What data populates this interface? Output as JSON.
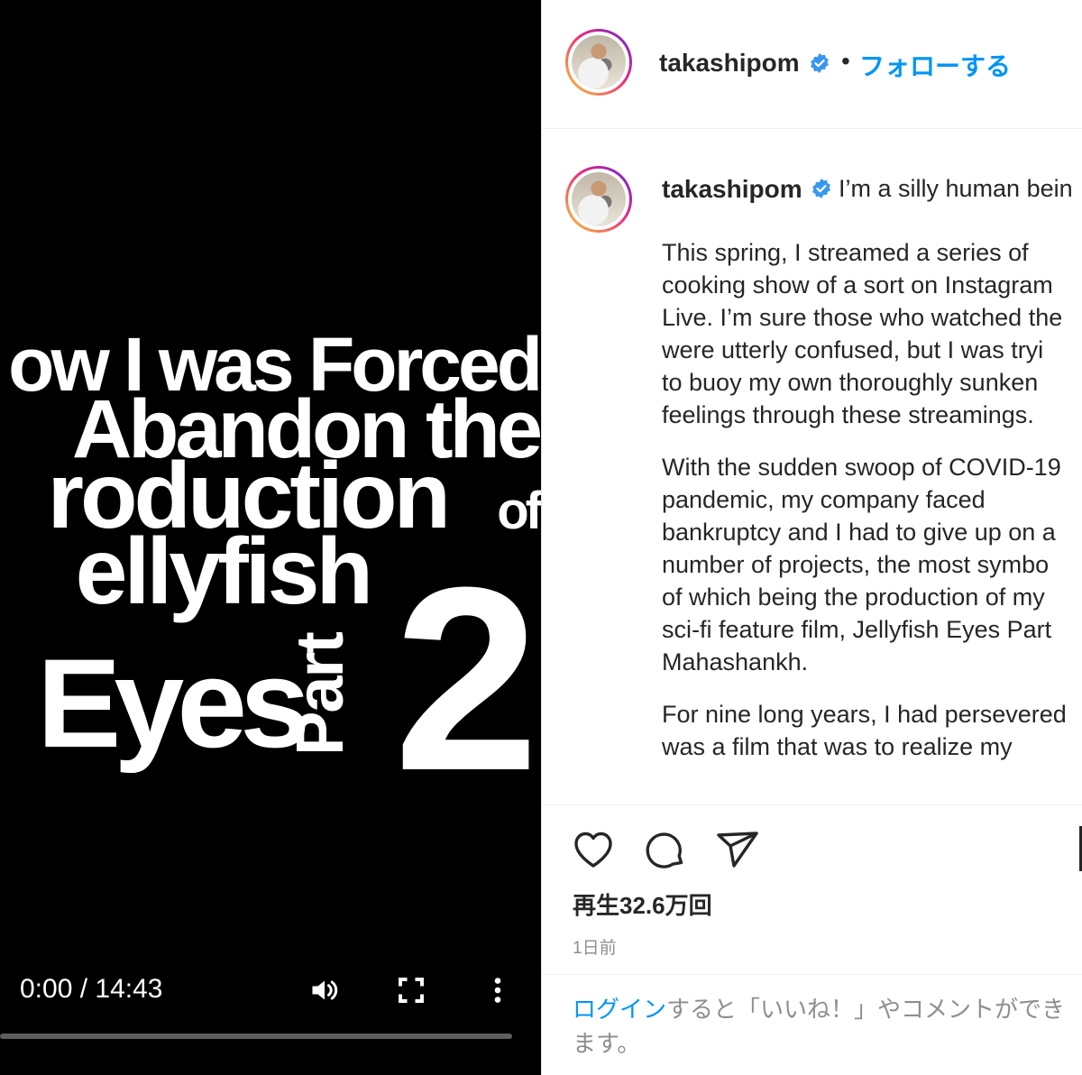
{
  "video": {
    "title_lines": [
      "ow I was Forced",
      "Abandon the",
      "roduction",
      "of",
      "ellyfish",
      "Eyes",
      "Part",
      "2"
    ],
    "time_current": "0:00",
    "time_total": "14:43",
    "time_display": "0:00 / 14:43",
    "progress_fraction": 0.0,
    "icons": [
      "volume-icon",
      "fullscreen-icon",
      "more-options-icon"
    ]
  },
  "header": {
    "username": "takashipom",
    "dot": "•",
    "follow_label": "フォローする"
  },
  "caption": {
    "username": "takashipom",
    "first_line": "I’m a silly human bein",
    "paragraphs": [
      "This spring, I streamed a series of\ncooking show of a sort on Instagram\nLive. I’m sure those who watched the\nwere utterly confused, but I was tryi\nto buoy my own thoroughly sunken\nfeelings through these streamings.",
      "With the sudden swoop of COVID-19\npandemic, my company faced\nbankruptcy and I had to give up on a\nnumber of projects, the most symbo\nof which being the production of my\nsci-fi feature film, Jellyfish Eyes Part\nMahashankh.",
      "For nine long years, I had persevered\nwas a film that was to realize my"
    ]
  },
  "actions": [
    "heart-icon",
    "comment-icon",
    "share-icon",
    "bookmark-icon"
  ],
  "stats": {
    "views": "再生32.6万回",
    "time_ago": "1日前"
  },
  "footer": {
    "login_link": "ログイン",
    "login_text": "すると「いいね！」やコメントができ\nます。"
  },
  "colors": {
    "accent": "#0095f6",
    "verified": "#3897f0",
    "text": "#262626",
    "muted": "#8e8e8e"
  }
}
